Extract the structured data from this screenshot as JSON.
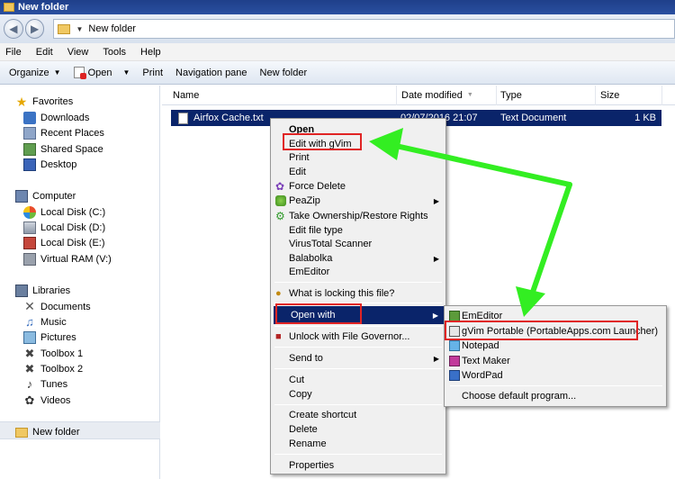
{
  "window": {
    "title": "New folder"
  },
  "address": {
    "path": "New folder"
  },
  "menubar": [
    "File",
    "Edit",
    "View",
    "Tools",
    "Help"
  ],
  "toolbar": {
    "organize": "Organize",
    "open": "Open",
    "print": "Print",
    "navigation_pane": "Navigation pane",
    "new_folder": "New folder"
  },
  "nav": {
    "favorites": "Favorites",
    "downloads": "Downloads",
    "recent_places": "Recent Places",
    "shared_space": "Shared Space",
    "desktop": "Desktop",
    "computer": "Computer",
    "local_c": "Local Disk (C:)",
    "local_d": "Local Disk (D:)",
    "local_e": "Local Disk (E:)",
    "virtual_ram": "Virtual RAM (V:)",
    "libraries": "Libraries",
    "documents": "Documents",
    "music": "Music",
    "pictures": "Pictures",
    "toolbox1": "Toolbox 1",
    "toolbox2": "Toolbox 2",
    "tunes": "Tunes",
    "videos": "Videos",
    "new_folder": "New folder"
  },
  "columns": {
    "name": "Name",
    "date_modified": "Date modified",
    "type": "Type",
    "size": "Size"
  },
  "file": {
    "name": "Airfox Cache.txt",
    "date": "02/07/2016 21:07",
    "type": "Text Document",
    "size": "1 KB"
  },
  "context_menu": {
    "open": "Open",
    "edit_gvim": "Edit with gVim",
    "print": "Print",
    "edit": "Edit",
    "force_delete": "Force Delete",
    "peazip": "PeaZip",
    "take_ownership": "Take Ownership/Restore Rights",
    "edit_file_type": "Edit file type",
    "virustotal": "VirusTotal Scanner",
    "balabolka": "Balabolka",
    "emeditor": "EmEditor",
    "what_locking": "What is locking this file?",
    "open_with": "Open with",
    "unlock": "Unlock with File Governor...",
    "send_to": "Send to",
    "cut": "Cut",
    "copy": "Copy",
    "create_shortcut": "Create shortcut",
    "delete": "Delete",
    "rename": "Rename",
    "properties": "Properties"
  },
  "open_with_menu": {
    "emeditor": "EmEditor",
    "gvim_portable": "gVim Portable (PortableApps.com Launcher)",
    "notepad": "Notepad",
    "text_maker": "Text Maker",
    "wordpad": "WordPad",
    "choose_default": "Choose default program..."
  },
  "colors": {
    "selection": "#0a246a",
    "annotation_red": "#e02424",
    "annotation_green": "#33ee22"
  }
}
